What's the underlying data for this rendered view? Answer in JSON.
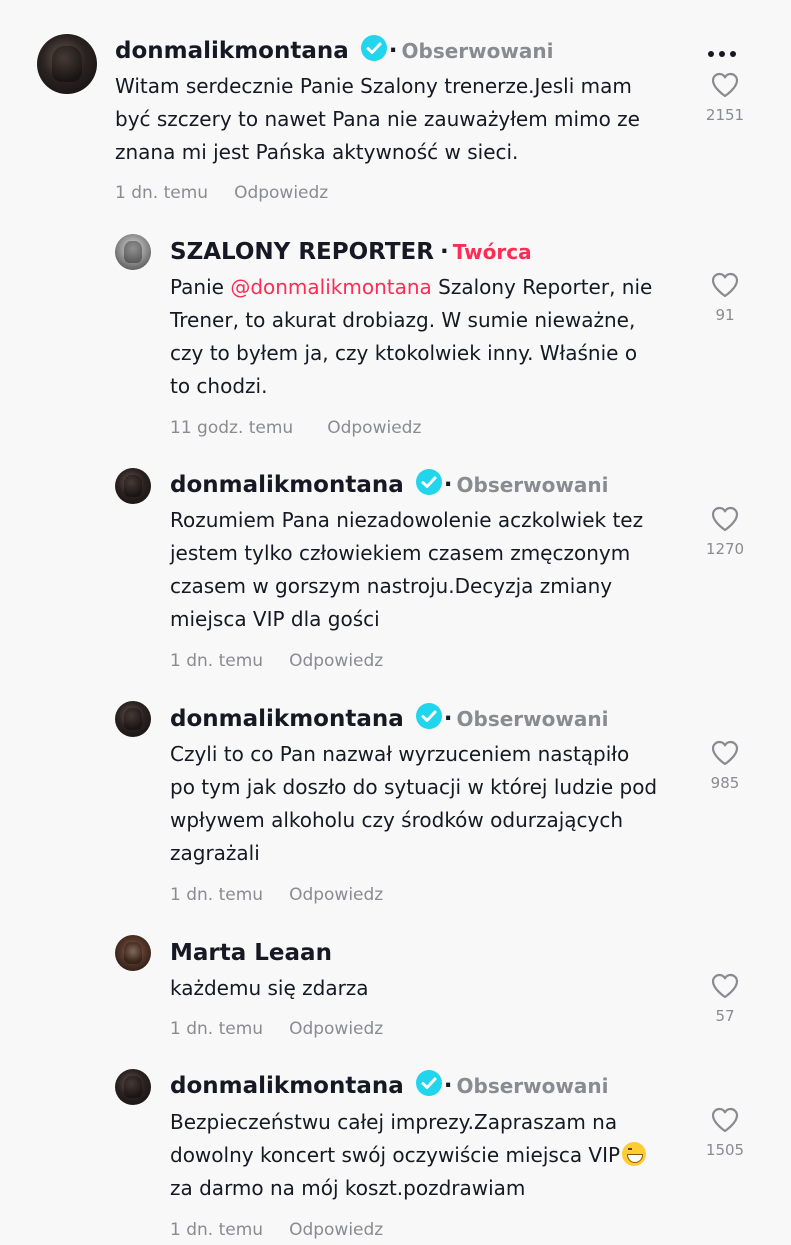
{
  "comments": [
    {
      "username": "donmalikmontana",
      "badge": "Obserwowani",
      "lines": [
        "Witam serdecznie Panie Szalony trenerze.Jesli mam",
        "być szczery to nawet Pana nie zauważyłem mimo ze",
        "znana mi jest Pańska aktywność w sieci."
      ],
      "time": "1 dn. temu",
      "reply": "Odpowiedz",
      "likes": "2151"
    },
    {
      "username": "SZALONY REPORTER",
      "badge": "Twórca",
      "line1_prefix": "Panie ",
      "mention": "@donmalikmontana",
      "line1_suffix": " Szalony Reporter, nie",
      "lines": [
        "Trener, to akurat drobiazg. W sumie nieważne,",
        "czy to byłem ja, czy ktokolwiek inny. Właśnie o",
        "to chodzi."
      ],
      "time": "11 godz. temu",
      "reply": "Odpowiedz",
      "likes": "91"
    },
    {
      "username": "donmalikmontana",
      "badge": "Obserwowani",
      "lines": [
        "Rozumiem Pana niezadowolenie aczkolwiek tez",
        "jestem tylko człowiekiem czasem zmęczonym",
        "czasem w gorszym nastroju.Decyzja zmiany",
        "miejsca VIP dla gości"
      ],
      "time": "1 dn. temu",
      "reply": "Odpowiedz",
      "likes": "1270"
    },
    {
      "username": "donmalikmontana",
      "badge": "Obserwowani",
      "lines": [
        "Czyli to co Pan nazwał wyrzuceniem nastąpiło",
        "po tym jak doszło do sytuacji w której ludzie pod",
        "wpływem alkoholu czy środków odurzających",
        "zagrażali"
      ],
      "time": "1 dn. temu",
      "reply": "Odpowiedz",
      "likes": "985"
    },
    {
      "username": "Marta Leaan",
      "lines": [
        "każdemu się zdarza"
      ],
      "time": "1 dn. temu",
      "reply": "Odpowiedz",
      "likes": "57"
    },
    {
      "username": "donmalikmontana",
      "badge": "Obserwowani",
      "lines": [
        "Bezpieczeństwu całej imprezy.Zapraszam na",
        "dowolny koncert swój oczywiście miejsca VIP",
        "za darmo na mój koszt.pozdrawiam"
      ],
      "time": "1 dn. temu",
      "reply": "Odpowiedz",
      "likes": "1505"
    }
  ],
  "icons": {
    "verified": "verified-badge-icon",
    "like": "heart-icon",
    "more": "more-options-icon",
    "emoji": "grinning-emoji-icon"
  },
  "colors": {
    "verified": "#20d5ec",
    "creator": "#fe2c55",
    "mention": "#fe2c55",
    "muted": "#8a8b91"
  }
}
